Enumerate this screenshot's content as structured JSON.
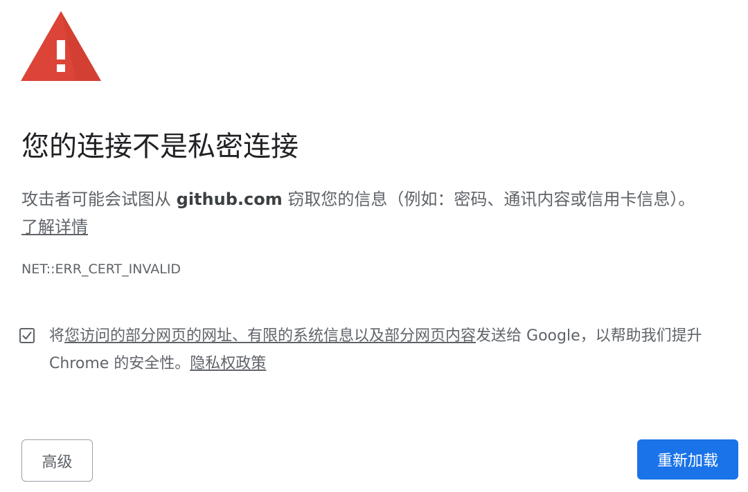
{
  "warning_icon": "warning-triangle-icon",
  "heading": "您的连接不是私密连接",
  "explanation": {
    "before": "攻击者可能会试图从 ",
    "domain": "github.com",
    "after": " 窃取您的信息（例如：密码、通讯内容或信用卡信息）。",
    "learn_more": "了解详情"
  },
  "error_code": "NET::ERR_CERT_INVALID",
  "optin": {
    "checked": true,
    "prefix": "将",
    "link": "您访问的部分网页的网址、有限的系统信息以及部分网页内容",
    "suffix": "发送给 Google，以帮助我们提升",
    "line2": "Chrome 的安全性。",
    "privacy_link": "隐私权政策"
  },
  "buttons": {
    "advanced": "高级",
    "reload": "重新加载"
  },
  "colors": {
    "warning": "#db4437",
    "primary": "#1a73e8",
    "text_secondary": "#5f6368"
  }
}
